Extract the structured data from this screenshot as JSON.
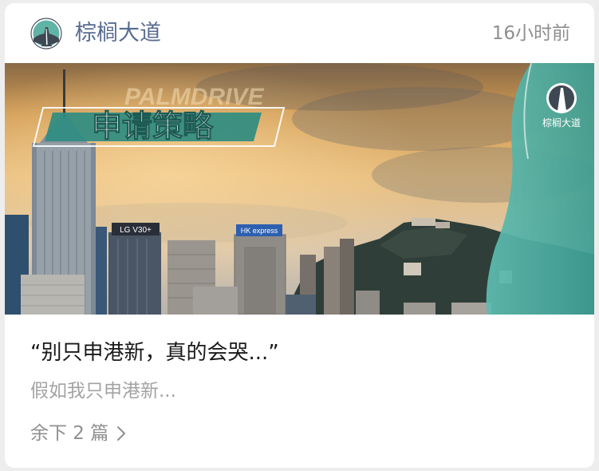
{
  "header": {
    "account_name": "棕榈大道",
    "time": "16小时前",
    "avatar_icon": "palmdrive-road-logo-icon"
  },
  "banner": {
    "badge_text": "申请策略",
    "watermark_text": "PALMDRIVE",
    "logo_caption": "棕榈大道",
    "billboard_1": "LG V30+",
    "billboard_2": "HK express",
    "scene": "hong-kong-skyline-at-sunset"
  },
  "article": {
    "title": "“别只申港新，真的会哭...”",
    "digest": "假如我只申港新..."
  },
  "more": {
    "label": "余下 2 篇",
    "icon": "chevron-right-icon"
  },
  "colors": {
    "accent_teal": "#4fb0a4",
    "account_name": "#586b91",
    "muted": "#8f8f8f"
  }
}
